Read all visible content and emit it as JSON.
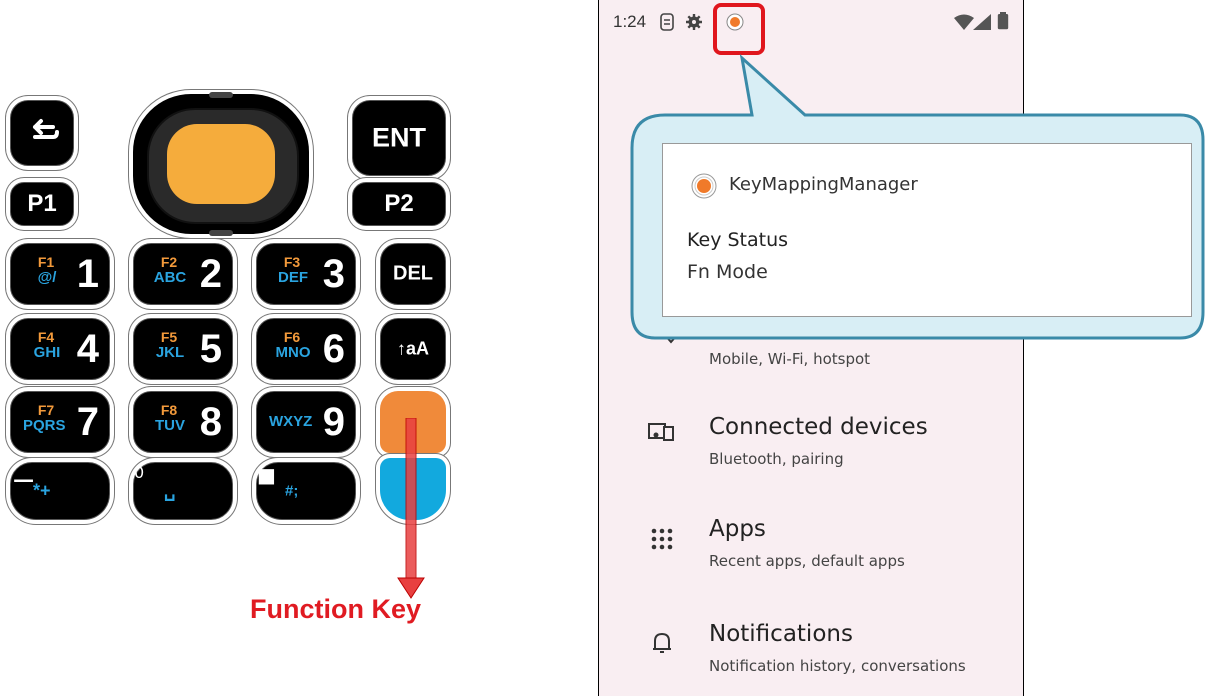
{
  "keypad": {
    "ent_label": "ENT",
    "p1_label": "P1",
    "p2_label": "P2",
    "del_label": "DEL",
    "shift_label": "↑aA",
    "number_keys": [
      {
        "fn": "F1",
        "alpha": "@/",
        "digit": "1"
      },
      {
        "fn": "F2",
        "alpha": "ABC",
        "digit": "2"
      },
      {
        "fn": "F3",
        "alpha": "DEF",
        "digit": "3"
      },
      {
        "fn": "F4",
        "alpha": "GHI",
        "digit": "4"
      },
      {
        "fn": "F5",
        "alpha": "JKL",
        "digit": "5"
      },
      {
        "fn": "F6",
        "alpha": "MNO",
        "digit": "6"
      },
      {
        "fn": "F7",
        "alpha": "PQRS",
        "digit": "7"
      },
      {
        "fn": "F8",
        "alpha": "TUV",
        "digit": "8"
      },
      {
        "fn": "",
        "alpha": "WXYZ",
        "digit": "9"
      },
      {
        "fn": "",
        "alpha": "*+",
        "digit": "−"
      },
      {
        "fn": "",
        "alpha": "␣",
        "digit": "0"
      },
      {
        "fn": "",
        "alpha": "#;",
        "digit": "■"
      }
    ],
    "function_key_caption": "Function Key",
    "colors": {
      "scan": "#f5ac3c",
      "function": "#f08a3a",
      "blue": "#12a9de",
      "fn_text": "#f39a3b",
      "alpha_text": "#2aa4e0",
      "caption": "#e01b22"
    }
  },
  "status_bar": {
    "time": "1:24",
    "icons": [
      "sim-icon",
      "gear-icon",
      "keymapping-notification-icon",
      "wifi-icon",
      "signal-icon",
      "battery-icon"
    ]
  },
  "notification": {
    "app_name": "KeyMappingManager",
    "title": "Key Status",
    "text": "Fn Mode"
  },
  "settings": [
    {
      "title": "",
      "subtitle": "Mobile, Wi-Fi, hotspot",
      "icon": "network-icon"
    },
    {
      "title": "Connected devices",
      "subtitle": "Bluetooth, pairing",
      "icon": "connected-devices-icon"
    },
    {
      "title": "Apps",
      "subtitle": "Recent apps, default apps",
      "icon": "apps-icon"
    },
    {
      "title": "Notifications",
      "subtitle": "Notification history, conversations",
      "icon": "bell-icon"
    }
  ]
}
